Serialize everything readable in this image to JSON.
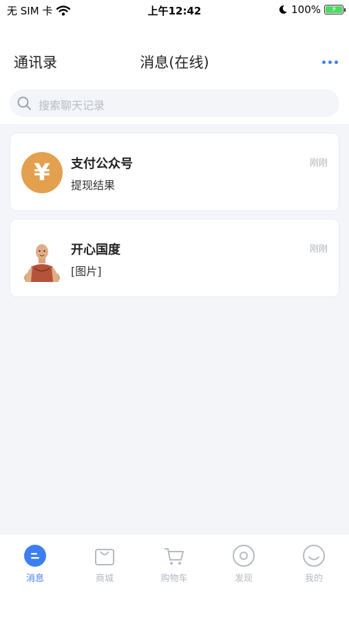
{
  "status_bar": {
    "carrier": "无 SIM 卡",
    "time": "上午12:42",
    "battery": "100%"
  },
  "header": {
    "contacts": "通讯录",
    "title": "消息(在线)"
  },
  "search": {
    "placeholder": "搜索聊天记录"
  },
  "conversations": [
    {
      "name": "支付公众号",
      "preview": "提现结果",
      "time": "刚刚",
      "avatar": "yen-icon",
      "avatar_color": "#e3a04e"
    },
    {
      "name": "开心国度",
      "preview": "[图片]",
      "time": "刚刚",
      "avatar": "person-avatar"
    }
  ],
  "tabs": [
    {
      "label": "消息",
      "icon": "message-icon",
      "active": true
    },
    {
      "label": "商城",
      "icon": "shopping-bag-icon"
    },
    {
      "label": "购物车",
      "icon": "cart-icon"
    },
    {
      "label": "发现",
      "icon": "discover-icon"
    },
    {
      "label": "我的",
      "icon": "smile-icon"
    }
  ],
  "colors": {
    "accent": "#3d7ff0",
    "background": "#f3f5f9",
    "inactive": "#b4b9c1"
  }
}
